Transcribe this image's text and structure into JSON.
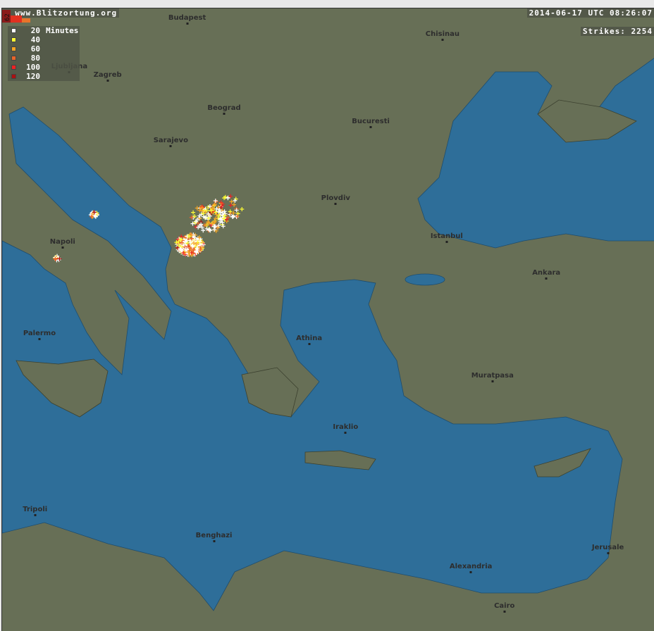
{
  "header": {
    "site": "© www.Blitzortung.org",
    "datetime": "2014-06-17 UTC 08:26:07",
    "strikes_label": "Strikes: 2254"
  },
  "legend": {
    "unit": "Minutes",
    "items": [
      {
        "minutes": "20",
        "color": "#ffffff"
      },
      {
        "minutes": "40",
        "color": "#ffff33"
      },
      {
        "minutes": "60",
        "color": "#f5a623"
      },
      {
        "minutes": "80",
        "color": "#e8652a"
      },
      {
        "minutes": "100",
        "color": "#ee2222"
      },
      {
        "minutes": "120",
        "color": "#aa1111"
      }
    ]
  },
  "colors": {
    "land": "#676f56",
    "sea": "#2e6e99",
    "border": "#c8c8c8"
  },
  "cities": [
    {
      "name": "Budapest",
      "lon": 19.04,
      "lat": 47.5
    },
    {
      "name": "Chisinau",
      "lon": 28.86,
      "lat": 47.01
    },
    {
      "name": "Ljubljana",
      "lon": 14.51,
      "lat": 46.06
    },
    {
      "name": "Zagreb",
      "lon": 15.98,
      "lat": 45.81
    },
    {
      "name": "Beograd",
      "lon": 20.46,
      "lat": 44.82
    },
    {
      "name": "Bucuresti",
      "lon": 26.1,
      "lat": 44.43
    },
    {
      "name": "Sarajevo",
      "lon": 18.41,
      "lat": 43.86
    },
    {
      "name": "Plovdiv",
      "lon": 24.75,
      "lat": 42.15
    },
    {
      "name": "Istanbul",
      "lon": 29.02,
      "lat": 41.01
    },
    {
      "name": "Napoli",
      "lon": 14.25,
      "lat": 40.85
    },
    {
      "name": "Ankara",
      "lon": 32.85,
      "lat": 39.93
    },
    {
      "name": "Athina",
      "lon": 23.73,
      "lat": 37.98
    },
    {
      "name": "Palermo",
      "lon": 13.36,
      "lat": 38.12
    },
    {
      "name": "Muratpasa",
      "lon": 30.78,
      "lat": 36.88
    },
    {
      "name": "Iraklio",
      "lon": 25.13,
      "lat": 35.34
    },
    {
      "name": "Tripoli",
      "lon": 13.19,
      "lat": 32.89
    },
    {
      "name": "Benghazi",
      "lon": 20.07,
      "lat": 32.12
    },
    {
      "name": "Alexandria",
      "lon": 29.95,
      "lat": 31.2
    },
    {
      "name": "Jerusale",
      "lon": 35.22,
      "lat": 31.77
    },
    {
      "name": "Cairo",
      "lon": 31.24,
      "lat": 30.04
    }
  ],
  "strike_clusters": [
    {
      "lon": 19.15,
      "lat": 40.9,
      "spread": 0.45,
      "count": 260
    },
    {
      "lon": 19.9,
      "lat": 41.7,
      "spread": 0.6,
      "count": 120
    },
    {
      "lon": 20.6,
      "lat": 42.0,
      "spread": 0.5,
      "count": 40
    },
    {
      "lon": 15.45,
      "lat": 41.8,
      "spread": 0.12,
      "count": 30
    },
    {
      "lon": 14.05,
      "lat": 40.5,
      "spread": 0.1,
      "count": 14
    }
  ],
  "histogram": {
    "label": "62"
  }
}
